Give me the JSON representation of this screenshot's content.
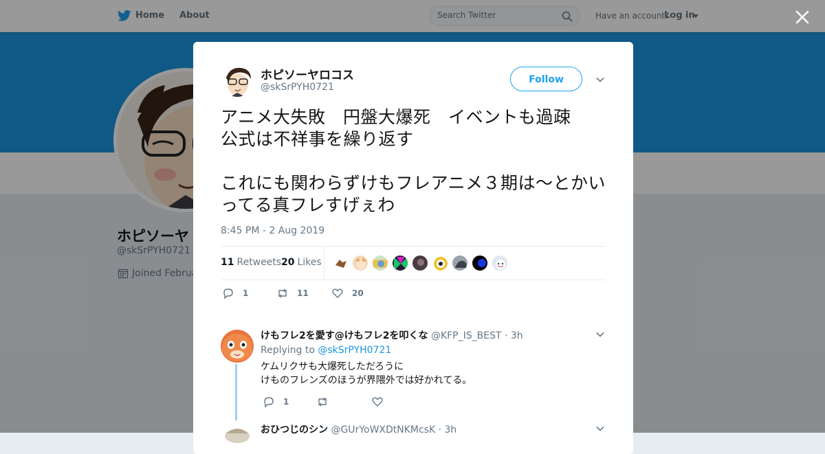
{
  "nav": {
    "home": "Home",
    "about": "About",
    "search_placeholder": "Search Twitter",
    "have_account": "Have an account?",
    "login": "Log in"
  },
  "profile": {
    "name": "ホピソーヤ",
    "handle": "@skSrPYH0721",
    "joined": "Joined Februa"
  },
  "tweet": {
    "author_name": "ホピソーヤロコス",
    "author_handle": "@skSrPYH0721",
    "follow_label": "Follow",
    "text": "アニメ大失敗　円盤大爆死　イベントも過疎　公式は不祥事を繰り返す\n\nこれにも関わらずけもフレアニメ３期は～とかいってる真フレすげぇわ",
    "timestamp": "8:45 PM - 2 Aug 2019",
    "retweets_count": "11",
    "retweets_label": "Retweets",
    "likes_count": "20",
    "likes_label": "Likes",
    "actions": {
      "reply": "1",
      "retweet": "11",
      "like": "20"
    }
  },
  "replies": [
    {
      "name": "けもフレ2を愛す@けもフレ2を叩くな",
      "handle": "@KFP_IS_BEST",
      "time": "· 3h",
      "replying_prefix": "Replying to",
      "replying_to": "@skSrPYH0721",
      "text": "ケムリクサも大爆死しただろうに\nけものフレンズのほうが界隈外では好かれてる。",
      "reply_count": "1"
    },
    {
      "name": "おひつじのシン",
      "handle": "@GUrYoWXDtNKMcsK",
      "time": "· 3h"
    }
  ],
  "colors": {
    "twitter_blue": "#1da1f2",
    "banner": "#1b95e0",
    "muted_text": "#657786",
    "thread_line": "#9ad0f5"
  },
  "icons": [
    "twitter-bird-icon",
    "search-icon",
    "close-icon",
    "calendar-icon",
    "chevron-down-icon",
    "reply-icon",
    "retweet-icon",
    "like-icon"
  ]
}
